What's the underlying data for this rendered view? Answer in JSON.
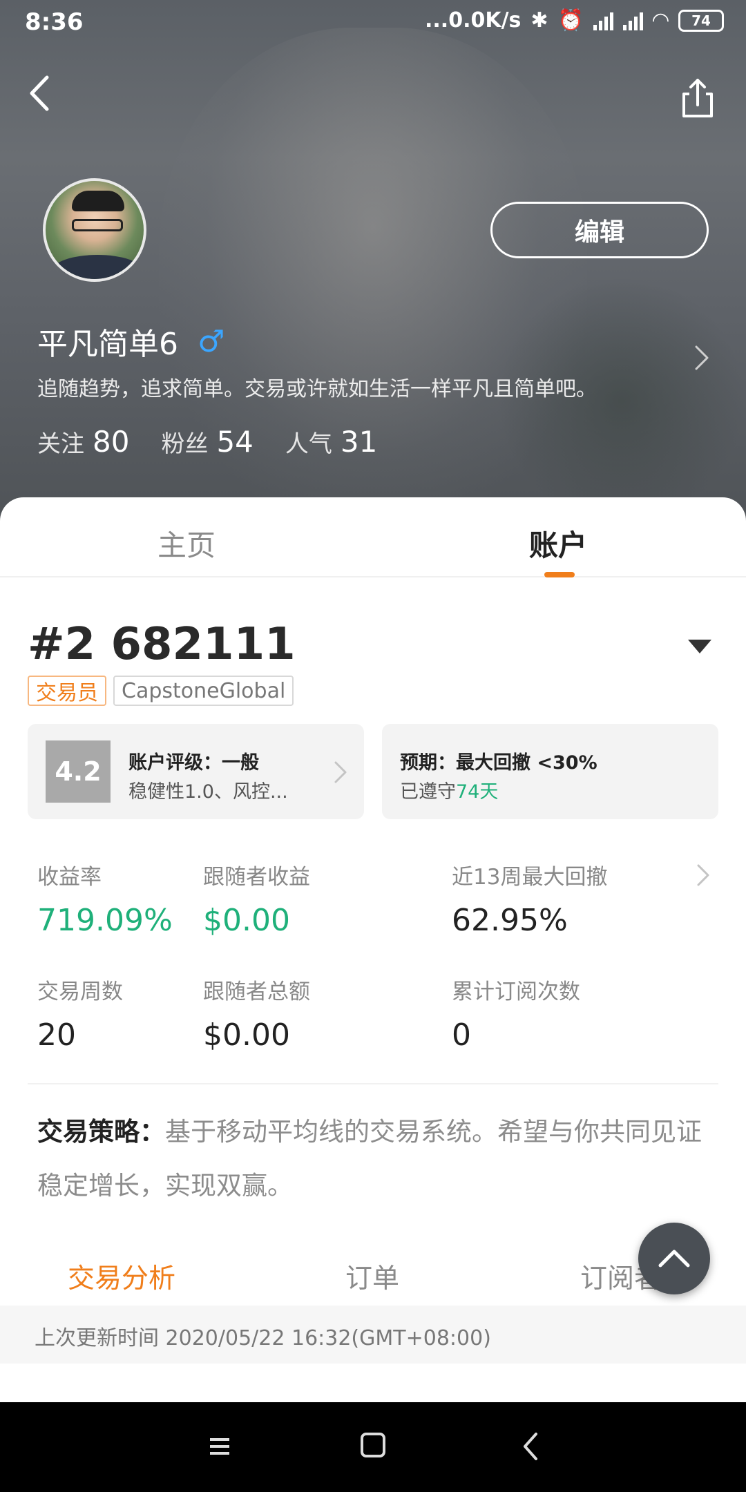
{
  "status_bar": {
    "time": "8:36",
    "network_speed": "...0.0K/s",
    "battery": "74"
  },
  "profile": {
    "name": "平凡简单6",
    "gender_symbol": "♂",
    "bio": "追随趋势，追求简单。交易或许就如生活一样平凡且简单吧。",
    "edit_label": "编辑",
    "stats": [
      {
        "label": "关注",
        "value": "80"
      },
      {
        "label": "粉丝",
        "value": "54"
      },
      {
        "label": "人气",
        "value": "31"
      }
    ]
  },
  "tabs_top": {
    "home": "主页",
    "account": "账户",
    "active": "account"
  },
  "account": {
    "number": "#2 682111",
    "role_tag": "交易员",
    "broker_tag": "CapstoneGlobal",
    "rating": {
      "score": "4.2",
      "title": "账户评级：一般",
      "subtitle": "稳健性1.0、风控..."
    },
    "expectation": {
      "title": "预期：最大回撤 <30%",
      "sub_prefix": "已遵守",
      "sub_value": "74天"
    },
    "metrics": [
      {
        "label": "收益率",
        "value": "719.09%",
        "highlight": true
      },
      {
        "label": "跟随者收益",
        "value": "$0.00",
        "highlight": true
      },
      {
        "label": "近13周最大回撤",
        "value": "62.95%",
        "highlight": false
      },
      {
        "label": "交易周数",
        "value": "20",
        "highlight": false
      },
      {
        "label": "跟随者总额",
        "value": "$0.00",
        "highlight": false
      },
      {
        "label": "累计订阅次数",
        "value": "0",
        "highlight": false
      }
    ],
    "strategy_label": "交易策略：",
    "strategy_text": "基于移动平均线的交易系统。希望与你共同见证稳定增长，实现双赢。"
  },
  "tabs_bottom": {
    "analysis": "交易分析",
    "orders": "订单",
    "subscribers": "订阅者",
    "active": "analysis"
  },
  "update": {
    "text": "上次更新时间 2020/05/22 16:32(GMT+08:00)"
  },
  "colors": {
    "accent_orange": "#f07e1b",
    "gain_green": "#1fb07a",
    "gender_blue": "#3ba6ff"
  },
  "icons": [
    "back-arrow-icon",
    "share-icon",
    "chevron-right-icon",
    "dropdown-caret-icon",
    "scroll-top-icon",
    "nav-menu-icon",
    "nav-home-icon",
    "nav-back-icon"
  ]
}
